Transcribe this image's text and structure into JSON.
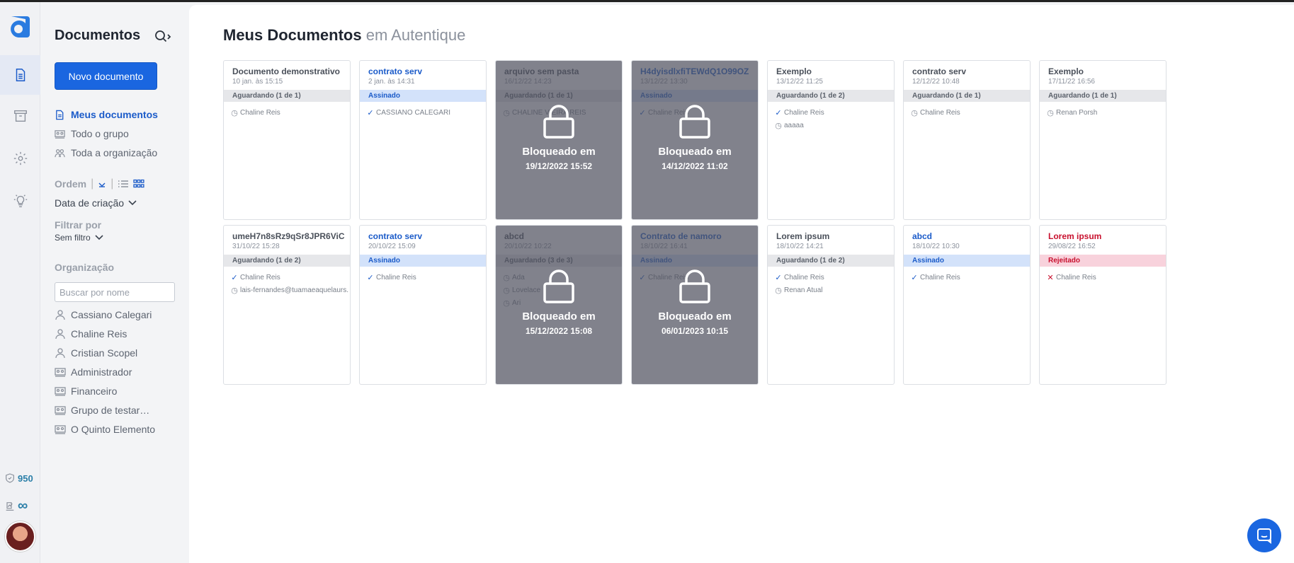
{
  "rail": {
    "credits_value": "950",
    "signatures_value": "∞",
    "accent_color": "#1a66e0"
  },
  "sidebar": {
    "title": "Documentos",
    "new_button": "Novo documento",
    "nav": [
      {
        "label": "Meus documentos",
        "icon": "document-icon"
      },
      {
        "label": "Todo o grupo",
        "icon": "group-icon"
      },
      {
        "label": "Toda a organização",
        "icon": "people-icon"
      }
    ],
    "ordem_label": "Ordem",
    "sort_value": "Data de criação",
    "filter_label": "Filtrar por",
    "filter_value": "Sem filtro",
    "org_label": "Organização",
    "org_search_placeholder": "Buscar por nome",
    "org_items": [
      {
        "label": "Cassiano Calegari",
        "type": "person"
      },
      {
        "label": "Chaline Reis",
        "type": "person"
      },
      {
        "label": "Cristian Scopel",
        "type": "person"
      },
      {
        "label": "Administrador",
        "type": "group"
      },
      {
        "label": "Financeiro",
        "type": "group"
      },
      {
        "label": "Grupo de testar…",
        "type": "group"
      },
      {
        "label": "O Quinto Elemento",
        "type": "group"
      }
    ]
  },
  "main": {
    "title": "Meus Documentos",
    "title_sub": "em Autentique"
  },
  "lock_label": "Bloqueado em",
  "cards": [
    {
      "title": "Documento demonstrativo",
      "color": "gray",
      "date": "10 jan. às 15:15",
      "status": "Aguardando (1 de 1)",
      "status_type": "waiting",
      "signers": [
        {
          "name": "Chaline Reis",
          "state": "pending"
        }
      ],
      "locked": false
    },
    {
      "title": "contrato serv",
      "color": "blue",
      "date": "2 jan. às 14:31",
      "status": "Assinado",
      "status_type": "signed",
      "signers": [
        {
          "name": "CASSIANO CALEGARI",
          "state": "signed"
        }
      ],
      "locked": false
    },
    {
      "title": "arquivo sem pasta",
      "color": "gray",
      "date": "16/12/22 14:23",
      "status": "Aguardando (1 de 1)",
      "status_type": "waiting",
      "signers": [
        {
          "name": "CHALINE VIEIRA REIS",
          "state": "pending"
        }
      ],
      "locked": true,
      "locked_at": "19/12/2022 15:52"
    },
    {
      "title": "H4dyisdlxfiTEWdQ1O99OZ",
      "color": "blue",
      "date": "13/12/22 13:30",
      "status": "Assinado",
      "status_type": "signed",
      "signers": [
        {
          "name": "Chaline Reis",
          "state": "signed"
        }
      ],
      "locked": true,
      "locked_at": "14/12/2022 11:02"
    },
    {
      "title": "Exemplo",
      "color": "gray",
      "date": "13/12/22 11:25",
      "status": "Aguardando (1 de 2)",
      "status_type": "waiting",
      "signers": [
        {
          "name": "Chaline Reis",
          "state": "signed"
        },
        {
          "name": "aaaaa",
          "state": "pending"
        }
      ],
      "locked": false
    },
    {
      "title": "contrato serv",
      "color": "gray",
      "date": "12/12/22 10:48",
      "status": "Aguardando (1 de 1)",
      "status_type": "waiting",
      "signers": [
        {
          "name": "Chaline Reis",
          "state": "pending"
        }
      ],
      "locked": false
    },
    {
      "title": "Exemplo",
      "color": "gray",
      "date": "17/11/22 16:56",
      "status": "Aguardando (1 de 1)",
      "status_type": "waiting",
      "signers": [
        {
          "name": "Renan Porsh",
          "state": "pending"
        }
      ],
      "locked": false
    },
    {
      "title": "umeH7n8sRz9qSr8JPR6ViC",
      "color": "gray",
      "date": "31/10/22 15:28",
      "status": "Aguardando (1 de 2)",
      "status_type": "waiting",
      "signers": [
        {
          "name": "Chaline Reis",
          "state": "signed"
        },
        {
          "name": "lais-fernandes@tuamaeaquelaurs.",
          "state": "pending"
        }
      ],
      "locked": false
    },
    {
      "title": "contrato serv",
      "color": "blue",
      "date": "20/10/22 15:09",
      "status": "Assinado",
      "status_type": "signed",
      "signers": [
        {
          "name": "Chaline Reis",
          "state": "signed"
        }
      ],
      "locked": false
    },
    {
      "title": "abcd",
      "color": "gray",
      "date": "20/10/22 10:22",
      "status": "Aguardando (3 de 3)",
      "status_type": "waiting",
      "signers": [
        {
          "name": "Ada",
          "state": "pending"
        },
        {
          "name": "Lovelace",
          "state": "pending"
        },
        {
          "name": "Ari",
          "state": "pending"
        }
      ],
      "locked": true,
      "locked_at": "15/12/2022 15:08"
    },
    {
      "title": "Contrato de namoro",
      "color": "blue",
      "date": "18/10/22 16:41",
      "status": "Assinado",
      "status_type": "signed",
      "signers": [
        {
          "name": "Chaline Reis",
          "state": "signed"
        }
      ],
      "locked": true,
      "locked_at": "06/01/2023 10:15"
    },
    {
      "title": "Lorem ipsum",
      "color": "gray",
      "date": "18/10/22 14:21",
      "status": "Aguardando (1 de 2)",
      "status_type": "waiting",
      "signers": [
        {
          "name": "Chaline Reis",
          "state": "signed"
        },
        {
          "name": "Renan Atual",
          "state": "pending"
        }
      ],
      "locked": false
    },
    {
      "title": "abcd",
      "color": "blue",
      "date": "18/10/22 10:30",
      "status": "Assinado",
      "status_type": "signed",
      "signers": [
        {
          "name": "Chaline Reis",
          "state": "signed"
        }
      ],
      "locked": false
    },
    {
      "title": "Lorem ipsum",
      "color": "red",
      "date": "29/08/22 16:52",
      "status": "Rejeitado",
      "status_type": "rejected",
      "signers": [
        {
          "name": "Chaline Reis",
          "state": "rejected"
        }
      ],
      "locked": false
    }
  ]
}
